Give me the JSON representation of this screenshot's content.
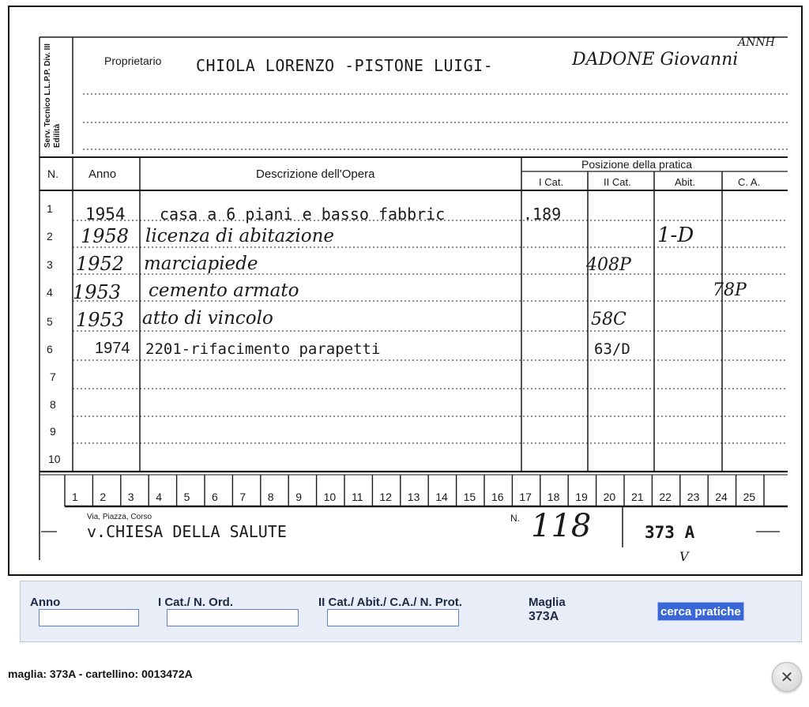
{
  "card": {
    "side_label": "Serv. Tecnico L.L.P.P. Div. III Edilità",
    "owner_label": "Proprietario",
    "owner_typed": "CHIOLA LORENZO -PISTONE LUIGI-",
    "owner_handwritten": "DADONE Giovanni",
    "corner_mark": "ANNH",
    "headers": {
      "n": "N.",
      "anno": "Anno",
      "descrizione": "Descrizione dell'Opera",
      "posizione": "Posizione della pratica",
      "icat": "I Cat.",
      "iicat": "II Cat.",
      "abit": "Abit.",
      "ca": "C. A."
    },
    "rows": [
      {
        "n": "1",
        "anno": "1954",
        "descrizione": "casa a 6 piani e basso fabbric",
        "icat": ".189",
        "iicat": "",
        "abit": "",
        "ca": ""
      },
      {
        "n": "2",
        "anno": "1958",
        "descrizione": "licenza di abitazione",
        "icat": "",
        "iicat": "",
        "abit": "1-D",
        "ca": ""
      },
      {
        "n": "3",
        "anno": "1952",
        "descrizione": "marciapiede",
        "icat": "",
        "iicat": "408P",
        "abit": "",
        "ca": ""
      },
      {
        "n": "4",
        "anno": "1953",
        "descrizione": "cemento armato",
        "icat": "",
        "iicat": "",
        "abit": "",
        "ca": "78P"
      },
      {
        "n": "5",
        "anno": "1953",
        "descrizione": "atto di vincolo",
        "icat": "",
        "iicat": "58C",
        "abit": "",
        "ca": ""
      },
      {
        "n": "6",
        "anno": "1974",
        "descrizione": "2201-rifacimento parapetti",
        "icat": "",
        "iicat": "63/D",
        "abit": "",
        "ca": ""
      },
      {
        "n": "7",
        "anno": "",
        "descrizione": "",
        "icat": "",
        "iicat": "",
        "abit": "",
        "ca": ""
      },
      {
        "n": "8",
        "anno": "",
        "descrizione": "",
        "icat": "",
        "iicat": "",
        "abit": "",
        "ca": ""
      },
      {
        "n": "9",
        "anno": "",
        "descrizione": "",
        "icat": "",
        "iicat": "",
        "abit": "",
        "ca": ""
      },
      {
        "n": "10",
        "anno": "",
        "descrizione": "",
        "icat": "",
        "iicat": "",
        "abit": "",
        "ca": ""
      }
    ],
    "ruler": [
      "1",
      "2",
      "3",
      "4",
      "5",
      "6",
      "7",
      "8",
      "9",
      "10",
      "11",
      "12",
      "13",
      "14",
      "15",
      "16",
      "17",
      "18",
      "19",
      "20",
      "21",
      "22",
      "23",
      "24",
      "25"
    ],
    "address_label": "Via, Piazza, Corso",
    "address_value": "v.CHIESA DELLA SALUTE",
    "number_label": "N.",
    "number_value": "118",
    "maglia_value": "373 A",
    "tick_mark": "V"
  },
  "search": {
    "anno_label": "Anno",
    "anno_value": "",
    "icat_label": "I Cat./ N. Ord.",
    "icat_value": "",
    "iicat_label": "II Cat./ Abit./ C.A./ N. Prot.",
    "iicat_value": "",
    "maglia_label": "Maglia",
    "maglia_value": "373A",
    "button_label": "cerca pratiche"
  },
  "footer": {
    "caption": "maglia: 373A - cartellino: 0013472A",
    "close_icon": "close-icon"
  }
}
